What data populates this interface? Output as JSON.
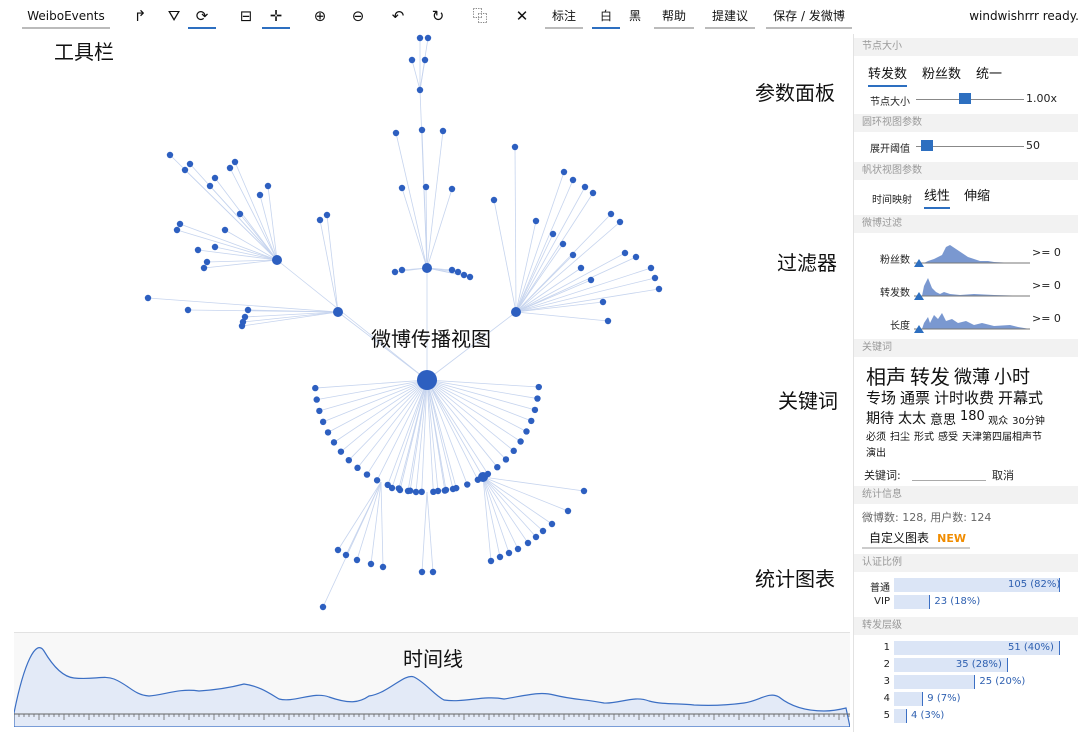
{
  "toolbar": {
    "app_label": "WeiboEvents",
    "tools": [
      {
        "name": "layout-tree-icon",
        "glyph": "↱"
      },
      {
        "name": "layout-fan-icon",
        "glyph": "⛛"
      },
      {
        "name": "layout-circle-icon",
        "glyph": "⟳"
      },
      {
        "name": "frame-icon",
        "glyph": "⊟"
      },
      {
        "name": "move-icon",
        "glyph": "✛"
      },
      {
        "name": "zoom-in-icon",
        "glyph": "⊕"
      },
      {
        "name": "zoom-out-icon",
        "glyph": "⊖"
      },
      {
        "name": "undo-icon",
        "glyph": "↶"
      },
      {
        "name": "redo-icon",
        "glyph": "↻"
      },
      {
        "name": "select-icon",
        "glyph": "⿻"
      },
      {
        "name": "close-icon",
        "glyph": "✕"
      }
    ],
    "annotate_label": "标注",
    "white_label": "白",
    "black_label": "黑",
    "help_label": "帮助",
    "suggest_label": "提建议",
    "save_label": "保存 / 发微博",
    "status": "windwishrrr ready."
  },
  "annotations": {
    "toolbar": "工具栏",
    "params_panel": "参数面板",
    "filter": "过滤器",
    "view": "微博传播视图",
    "keywords": "关键词",
    "stats_chart": "统计图表",
    "timeline": "时间线"
  },
  "panel": {
    "node_size_title": "节点大小",
    "node_size_tabs": [
      "转发数",
      "粉丝数",
      "统一"
    ],
    "node_size_label": "节点大小",
    "node_size_value": "1.00x",
    "node_size_level": 0.45,
    "ring_title": "圆环视图参数",
    "expand_label": "展开阈值",
    "expand_value": "50",
    "expand_level": 0.1,
    "sail_title": "帆状视图参数",
    "time_map_label": "时间映射",
    "time_map_tabs": [
      "线性",
      "伸缩"
    ],
    "filter_title": "微博过滤",
    "filters": [
      {
        "label": "粉丝数",
        "value": ">= 0"
      },
      {
        "label": "转发数",
        "value": ">= 0"
      },
      {
        "label": "长度",
        "value": ">= 0"
      }
    ],
    "keyword_title": "关键词",
    "keywords": [
      [
        {
          "t": "相声",
          "s": 20
        },
        {
          "t": "转发",
          "s": 20
        },
        {
          "t": "微薄",
          "s": 18
        },
        {
          "t": "小时",
          "s": 18
        }
      ],
      [
        {
          "t": "专场",
          "s": 15
        },
        {
          "t": "通票",
          "s": 15
        },
        {
          "t": "计时收费",
          "s": 15
        },
        {
          "t": "开幕式",
          "s": 15
        }
      ],
      [
        {
          "t": "期待",
          "s": 14
        },
        {
          "t": "太太",
          "s": 14
        },
        {
          "t": "意思",
          "s": 13
        },
        {
          "t": "180",
          "s": 13
        },
        {
          "t": "观众",
          "s": 10
        },
        {
          "t": "30分钟",
          "s": 10
        }
      ],
      [
        {
          "t": "必须",
          "s": 10
        },
        {
          "t": "扫尘",
          "s": 10
        },
        {
          "t": "形式",
          "s": 10
        },
        {
          "t": "感受",
          "s": 10
        },
        {
          "t": "天津第四届相声节",
          "s": 10
        }
      ],
      [
        {
          "t": "演出",
          "s": 10
        }
      ]
    ],
    "keyword_input_label": "关键词:",
    "cancel_label": "取消",
    "stats_title": "统计信息",
    "stats_text": "微博数: 128, 用户数: 124",
    "custom_chart_label": "自定义图表",
    "new_badge": "NEW",
    "cert_title": "认证比例",
    "repost_title": "转发层级",
    "accent": "#2d6fc0",
    "badge_color": "#f08c00"
  },
  "chart_data": [
    {
      "type": "bar",
      "title": "认证比例",
      "categories": [
        "普通",
        "VIP"
      ],
      "values": [
        105,
        23
      ],
      "labels": [
        "105 (82%)",
        "23 (18%)"
      ]
    },
    {
      "type": "bar",
      "title": "转发层级",
      "categories": [
        "1",
        "2",
        "3",
        "4",
        "5"
      ],
      "values": [
        51,
        35,
        25,
        9,
        4
      ],
      "labels": [
        "51 (40%)",
        "35 (28%)",
        "25 (20%)",
        "9 (7%)",
        "4 (3%)"
      ]
    }
  ]
}
